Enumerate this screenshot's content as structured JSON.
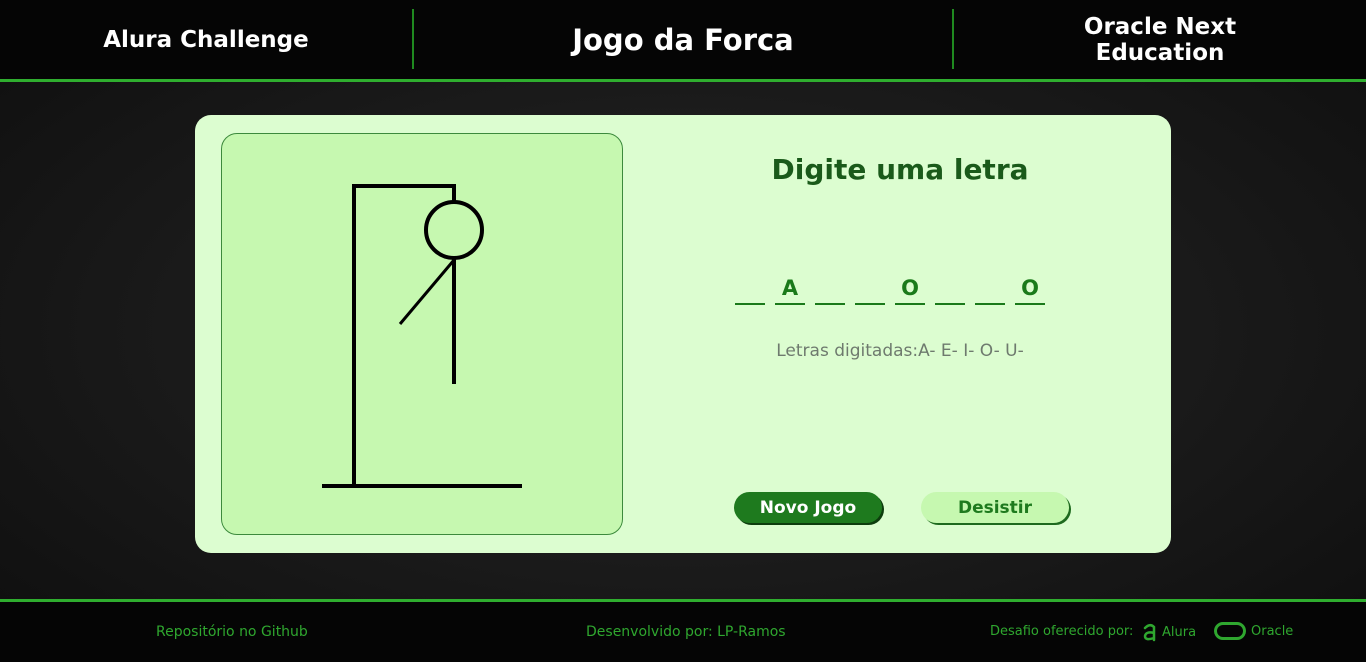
{
  "header": {
    "left_title": "Alura Challenge",
    "center_title": "Jogo da Forca",
    "right_title_line1": "Oracle Next",
    "right_title_line2": "Education"
  },
  "game": {
    "prompt": "Digite uma letra",
    "word_slots": [
      "",
      "A",
      "",
      "",
      "O",
      "",
      "",
      "O"
    ],
    "typed_label": "Letras digitadas:",
    "typed_letters": "A- E- I- O- U-",
    "new_game_label": "Novo Jogo",
    "give_up_label": "Desistir",
    "hangman_parts_drawn": [
      "head",
      "body",
      "left-arm"
    ]
  },
  "footer": {
    "repo_link": "Repositório no Github",
    "developer_text": "Desenvolvido por: LP-Ramos",
    "offered_by": "Desafio oferecido por:",
    "alura_label": "Alura",
    "oracle_label": "Oracle"
  },
  "colors": {
    "accent": "#2fae2f",
    "card_bg": "#dcfdd0",
    "gallows_bg": "#c6f8b0",
    "primary_button": "#1e7a1e",
    "title_green": "#1a5a1a"
  }
}
